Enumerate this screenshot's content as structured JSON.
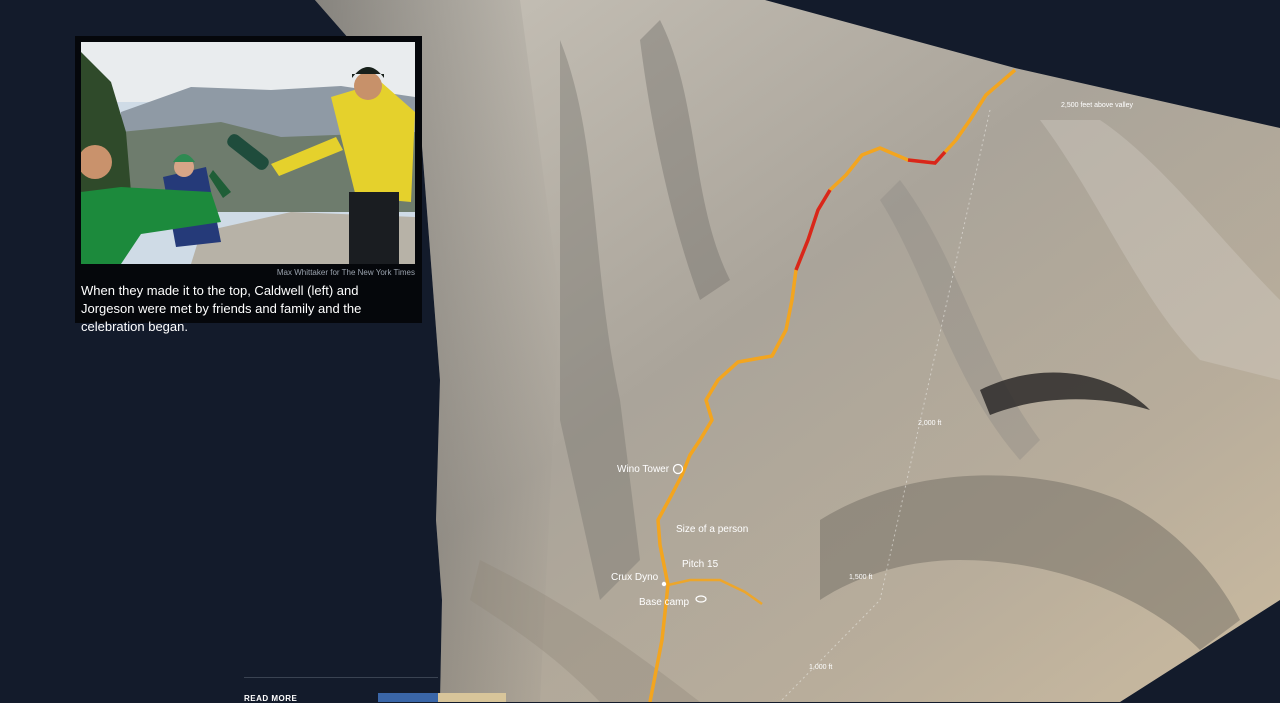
{
  "photo": {
    "credit": "Max Whittaker for The New York Times",
    "caption": "When they made it to the top, Caldwell (left) and Jorgeson were met by friends and family and the celebration began."
  },
  "map": {
    "labels": {
      "wino_tower": "Wino Tower",
      "size_of_person": "Size of a person",
      "pitch_15": "Pitch 15",
      "crux_dyno": "Crux Dyno",
      "base_camp": "Base camp",
      "elev_2500": "2,500 feet above valley",
      "elev_2000": "2,000 ft",
      "elev_1500": "1,500 ft",
      "elev_1000": "1,000 ft"
    }
  },
  "read_more": {
    "label": "READ MORE"
  },
  "colors": {
    "background": "#131b2b",
    "route_orange": "#f3a51f",
    "route_red": "#d8261c",
    "rock": "#b9b3a8"
  }
}
